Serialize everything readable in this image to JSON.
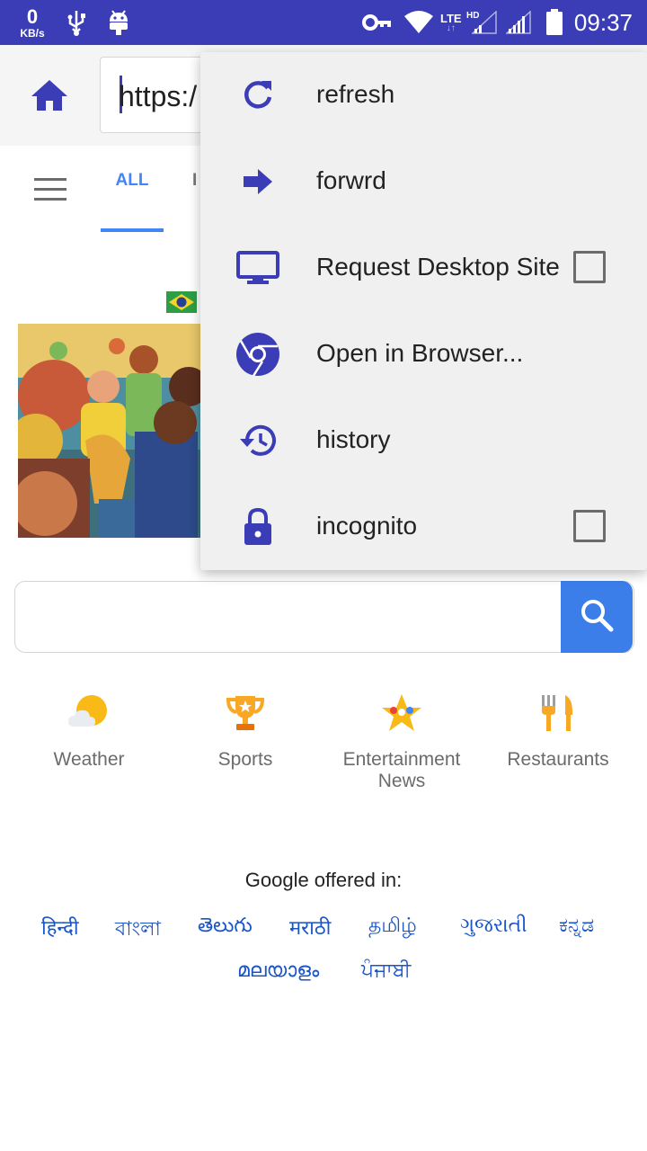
{
  "status_bar": {
    "speed_value": "0",
    "speed_unit": "KB/s",
    "network": "LTE",
    "network_arrows": "↓↑",
    "hd": "HD",
    "time": "09:37"
  },
  "toolbar": {
    "url": "https:/",
    "home_icon": "home-icon"
  },
  "tabs": {
    "all": "ALL",
    "images_partial": "I"
  },
  "shortcuts": [
    {
      "label": "Weather",
      "icon": "weather-icon"
    },
    {
      "label": "Sports",
      "icon": "trophy-icon"
    },
    {
      "label": "Entertainment News",
      "icon": "star-icon"
    },
    {
      "label": "Restaurants",
      "icon": "fork-knife-icon"
    }
  ],
  "languages": {
    "heading": "Google offered in:",
    "items": [
      "हिन्दी",
      "বাংলা",
      "తెలుగు",
      "मराठी",
      "தமிழ்",
      "ગુજરાતી",
      "ಕನ್ನಡ",
      "മലയാളം",
      "ਪੰਜਾਬੀ"
    ]
  },
  "menu": {
    "items": [
      {
        "label": "refresh",
        "icon": "refresh-icon"
      },
      {
        "label": "forwrd",
        "icon": "forward-arrow-icon"
      },
      {
        "label": "Request Desktop Site",
        "icon": "monitor-icon",
        "checkbox": false
      },
      {
        "label": "Open in Browser...",
        "icon": "chrome-icon"
      },
      {
        "label": "history",
        "icon": "history-icon"
      },
      {
        "label": "incognito",
        "icon": "lock-icon",
        "checkbox": false
      }
    ]
  },
  "colors": {
    "status_bar": "#3a3db5",
    "accent": "#3a3db5",
    "google_blue": "#4285f4",
    "search_button": "#3b7de9"
  }
}
